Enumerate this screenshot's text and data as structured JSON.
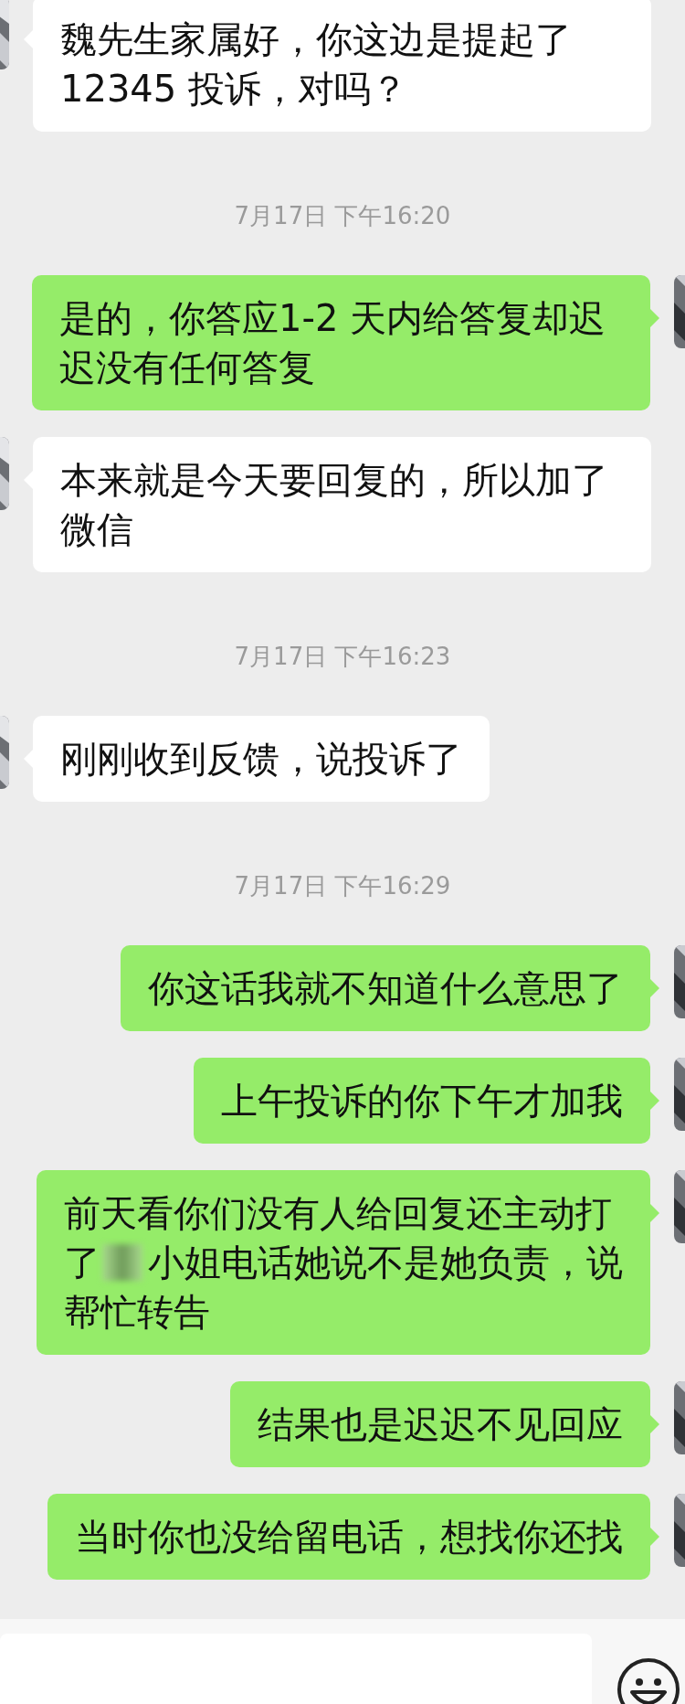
{
  "messages": [
    {
      "kind": "received",
      "text": "魏先生家属好，你这边是提起了12345 投诉，对吗？"
    },
    {
      "kind": "time",
      "text": "7月17日 下午16:20"
    },
    {
      "kind": "sent",
      "text": "是的，你答应1-2 天内给答复却迟迟没有任何答复"
    },
    {
      "kind": "received",
      "text": "本来就是今天要回复的，所以加了微信"
    },
    {
      "kind": "time",
      "text": "7月17日 下午16:23"
    },
    {
      "kind": "received",
      "text": "刚刚收到反馈，说投诉了"
    },
    {
      "kind": "time",
      "text": "7月17日 下午16:29"
    },
    {
      "kind": "sent",
      "text": "你这话我就不知道什么意思了"
    },
    {
      "kind": "sent",
      "text": "上午投诉的你下午才加我"
    },
    {
      "kind": "sent",
      "lines": [
        {
          "text": "前天看你们没有人给回复还主动打",
          "redacted": false
        },
        {
          "text": "了",
          "redacted": true,
          "text_after": "小姐电话她说不是她负责，说"
        },
        {
          "text": "帮忙转告",
          "redacted": false
        }
      ]
    },
    {
      "kind": "sent",
      "text": "结果也是迟迟不见回应"
    },
    {
      "kind": "sent",
      "text": "当时你也没给留电话，想找你还找"
    }
  ]
}
